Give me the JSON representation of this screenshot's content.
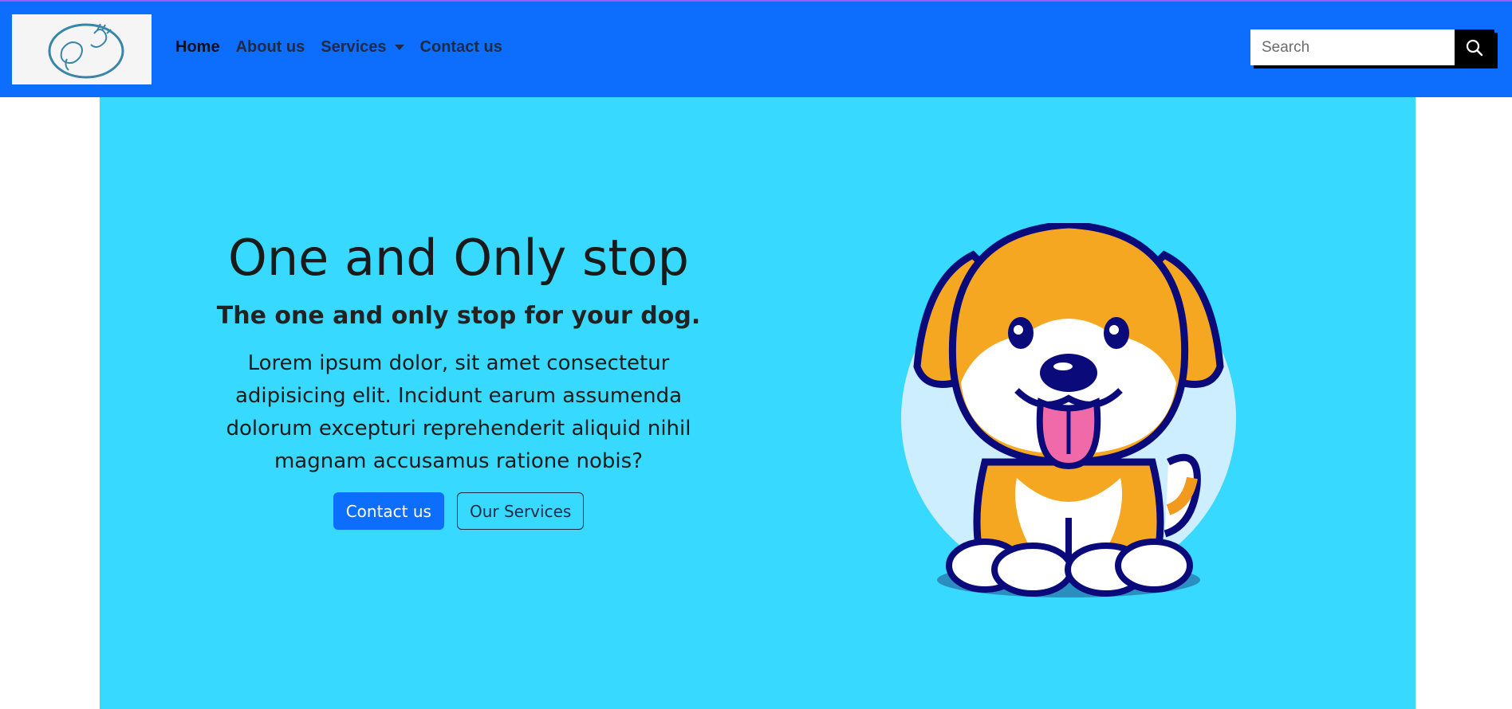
{
  "navbar": {
    "links": [
      {
        "label": "Home",
        "active": true
      },
      {
        "label": "About us"
      },
      {
        "label": "Services",
        "dropdown": true
      },
      {
        "label": "Contact us"
      }
    ],
    "search": {
      "placeholder": "Search",
      "value": ""
    }
  },
  "hero": {
    "title": "One and Only stop",
    "subtitle": "The one and only stop for your dog.",
    "body": "Lorem ipsum dolor, sit amet consectetur adipisicing elit. Incidunt earum assumenda dolorum excepturi reprehenderit aliquid nihil magnam accusamus ratione nobis?",
    "primary_button": "Contact us",
    "secondary_button": "Our Services"
  },
  "colors": {
    "navbar_bg": "#0d6efd",
    "hero_bg": "#38d9ff",
    "primary": "#0d6efd"
  },
  "icons": {
    "logo": "dog-hand-logo-icon",
    "search": "search-icon",
    "dropdown": "caret-down-icon",
    "illustration": "cartoon-dog-illustration"
  }
}
